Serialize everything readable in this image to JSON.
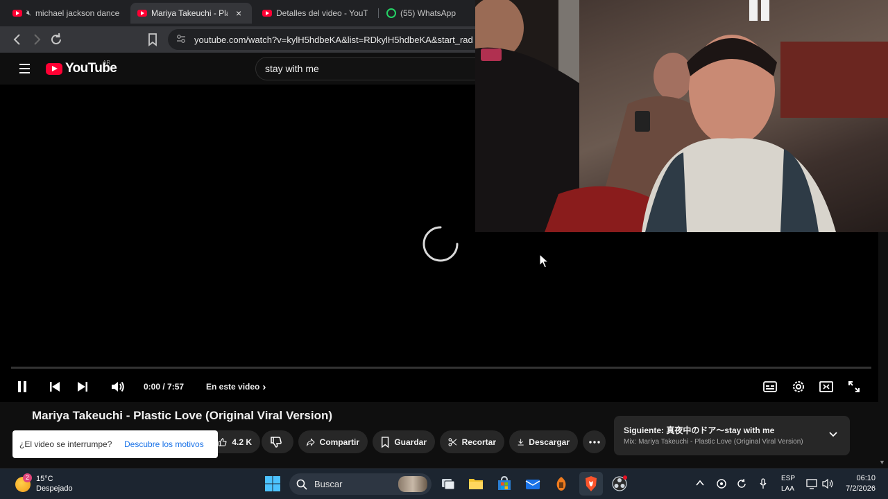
{
  "browser": {
    "tabs": [
      {
        "title": "michael jackson dance",
        "favicon": "youtube-icon",
        "muted": true
      },
      {
        "title": "Mariya Takeuchi - Plas",
        "favicon": "youtube-icon",
        "active": true,
        "close_label": "×"
      },
      {
        "title": "Detalles del video - YouTu",
        "favicon": "youtube-studio-icon"
      },
      {
        "title": "(55) WhatsApp",
        "favicon": "whatsapp-icon"
      }
    ],
    "url": "youtube.com/watch?v=kylH5hdbeKA&list=RDkylH5hdbeKA&start_rad"
  },
  "youtube": {
    "logo_text": "YouTube",
    "region": "AR",
    "search_query": "stay with me",
    "colors": {
      "brand": "#ff0033",
      "background": "#0f0f0f"
    }
  },
  "player": {
    "state": "loading",
    "time": "0:00 / 7:57",
    "chapters_label": "En este video",
    "chapters_chevron": "›"
  },
  "video": {
    "title": "Mariya Takeuchi - Plastic Love (Original Viral Version)",
    "like_count": "4.2 K",
    "actions": {
      "share": "Compartir",
      "save": "Guardar",
      "clip": "Recortar",
      "download": "Descargar"
    }
  },
  "toast": {
    "message": "¿El video se interrumpe?",
    "link": "Descubre los motivos"
  },
  "next_up": {
    "title": "Siguiente: 真夜中のドア〜stay with me",
    "subtitle": "Mix: Mariya Takeuchi - Plastic Love (Original Viral Version)"
  },
  "taskbar": {
    "weather_badge": "2",
    "temperature": "15°C",
    "condition": "Despejado",
    "search_label": "Buscar",
    "language": "ESP",
    "layout": "LAA",
    "time": "06:10",
    "date": "7/2/2026"
  }
}
